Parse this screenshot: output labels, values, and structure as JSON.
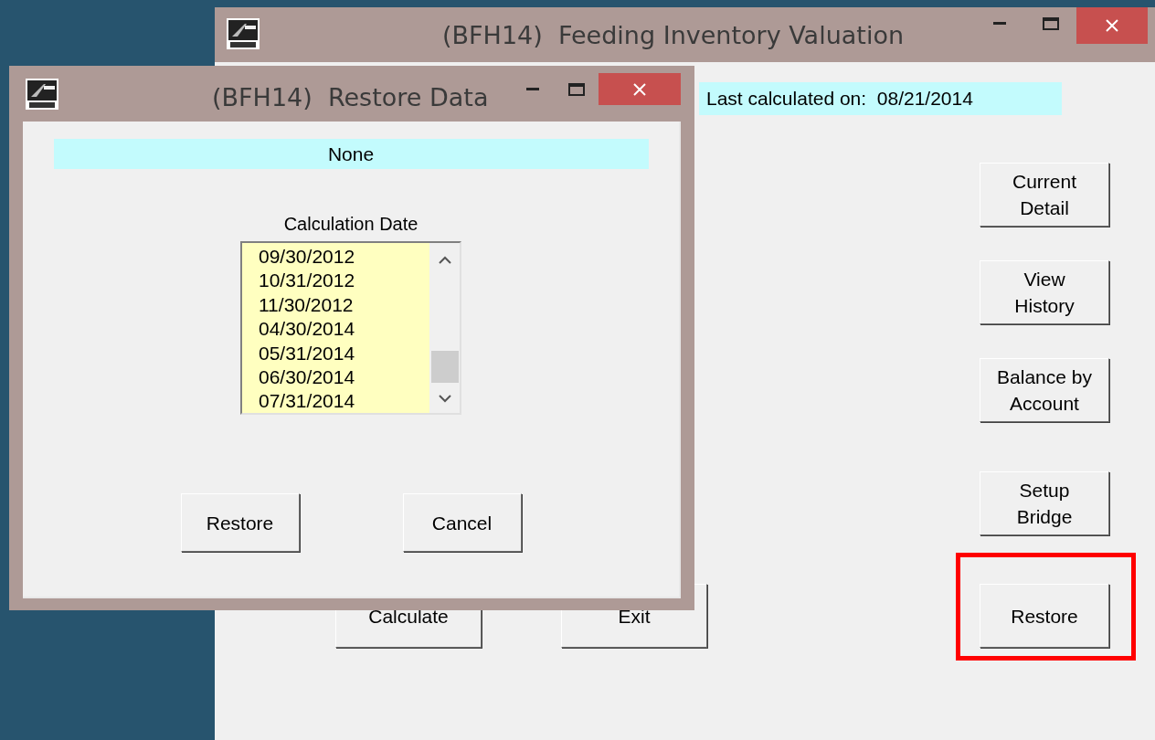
{
  "main_window": {
    "title": "(BFH14)  Feeding Inventory Valuation",
    "last_calculated": "Last calculated on:  08/21/2014",
    "side_buttons": [
      {
        "label": "Current\nDetail",
        "highlighted": false
      },
      {
        "label": "View\nHistory",
        "highlighted": false
      },
      {
        "label": "Balance by\nAccount",
        "highlighted": false
      },
      {
        "label": "Setup\nBridge",
        "highlighted": false
      },
      {
        "label": "Restore",
        "highlighted": true
      }
    ],
    "bottom_buttons": [
      "Calculate",
      "Exit"
    ]
  },
  "dialog": {
    "title": "(BFH14)  Restore Data",
    "status": "None",
    "list_label": "Calculation Date",
    "dates": [
      "09/30/2012",
      "10/31/2012",
      "11/30/2012",
      "04/30/2014",
      "05/31/2014",
      "06/30/2014",
      "07/31/2014"
    ],
    "buttons": [
      "Restore",
      "Cancel"
    ]
  }
}
